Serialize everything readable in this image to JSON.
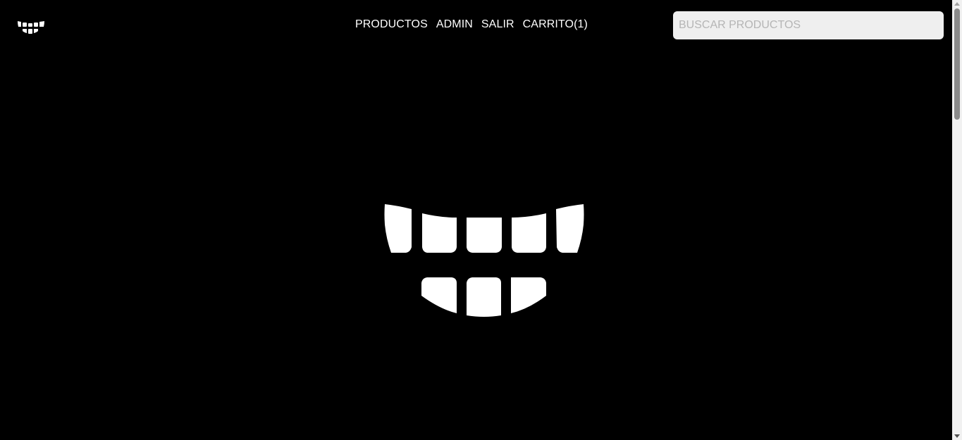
{
  "header": {
    "logo_icon": "teeth-logo-icon",
    "nav": {
      "productos": "PRODUCTOS",
      "admin": "ADMIN",
      "salir": "SALIR",
      "carrito": "CARRITO(1)"
    },
    "search": {
      "placeholder": "BUSCAR PRODUCTOS",
      "value": ""
    }
  },
  "main": {
    "hero_icon": "teeth-smile-icon"
  },
  "colors": {
    "background": "#000000",
    "text": "#ffffff",
    "search_bg": "#efefef",
    "search_placeholder": "#b5b5b5"
  }
}
